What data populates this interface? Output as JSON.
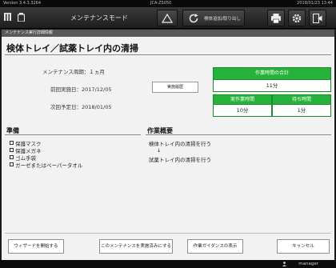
{
  "top_strip": {
    "version": "Version 3.4.3.3264",
    "model": "JCA-ZS050",
    "datetime": "2018/01/23 13:44"
  },
  "header": {
    "mode_title": "メンテナンスモード",
    "check_button_label": "検体追加/取り出し",
    "icons": [
      "tray-icon",
      "bottle-icon",
      "warning-icon",
      "refresh-icon",
      "printer-icon",
      "gear-icon",
      "exit-icon"
    ]
  },
  "sub_bar": {
    "title": "メンテナンス実行詳細情報"
  },
  "main": {
    "title": "検体トレイ／試薬トレイ内の清掃",
    "period": "メンテナンス周期：１ヵ月",
    "previous": "前回実施日：2017/12/05",
    "next": "次回予定日：2018/01/05",
    "history_button": "実施履歴"
  },
  "time_table": {
    "total_label": "作業時間の合計",
    "total_value": "11分",
    "exec_label": "実作業時間",
    "exec_value": "10分",
    "wait_label": "待ち時間",
    "wait_value": "1分"
  },
  "preparation": {
    "heading": "準備",
    "items": [
      "保護マスク",
      "保護メガネ",
      "ゴム手袋",
      "ガーゼまたはペーパータオル"
    ]
  },
  "overview": {
    "heading": "作業概要",
    "lines": [
      "検体トレイ内の清掃を行う",
      "↓",
      "試薬トレイ内の清掃を行う"
    ]
  },
  "footer": {
    "buttons": [
      "ウィザードを開始する",
      "このメンテナンスを実施済みにする",
      "作業ガイダンスの表示",
      "キャンセル"
    ]
  },
  "status": {
    "user": "manager"
  },
  "colors": {
    "accent_green": "#27b33b",
    "header_dark": "#2a2a2a"
  }
}
